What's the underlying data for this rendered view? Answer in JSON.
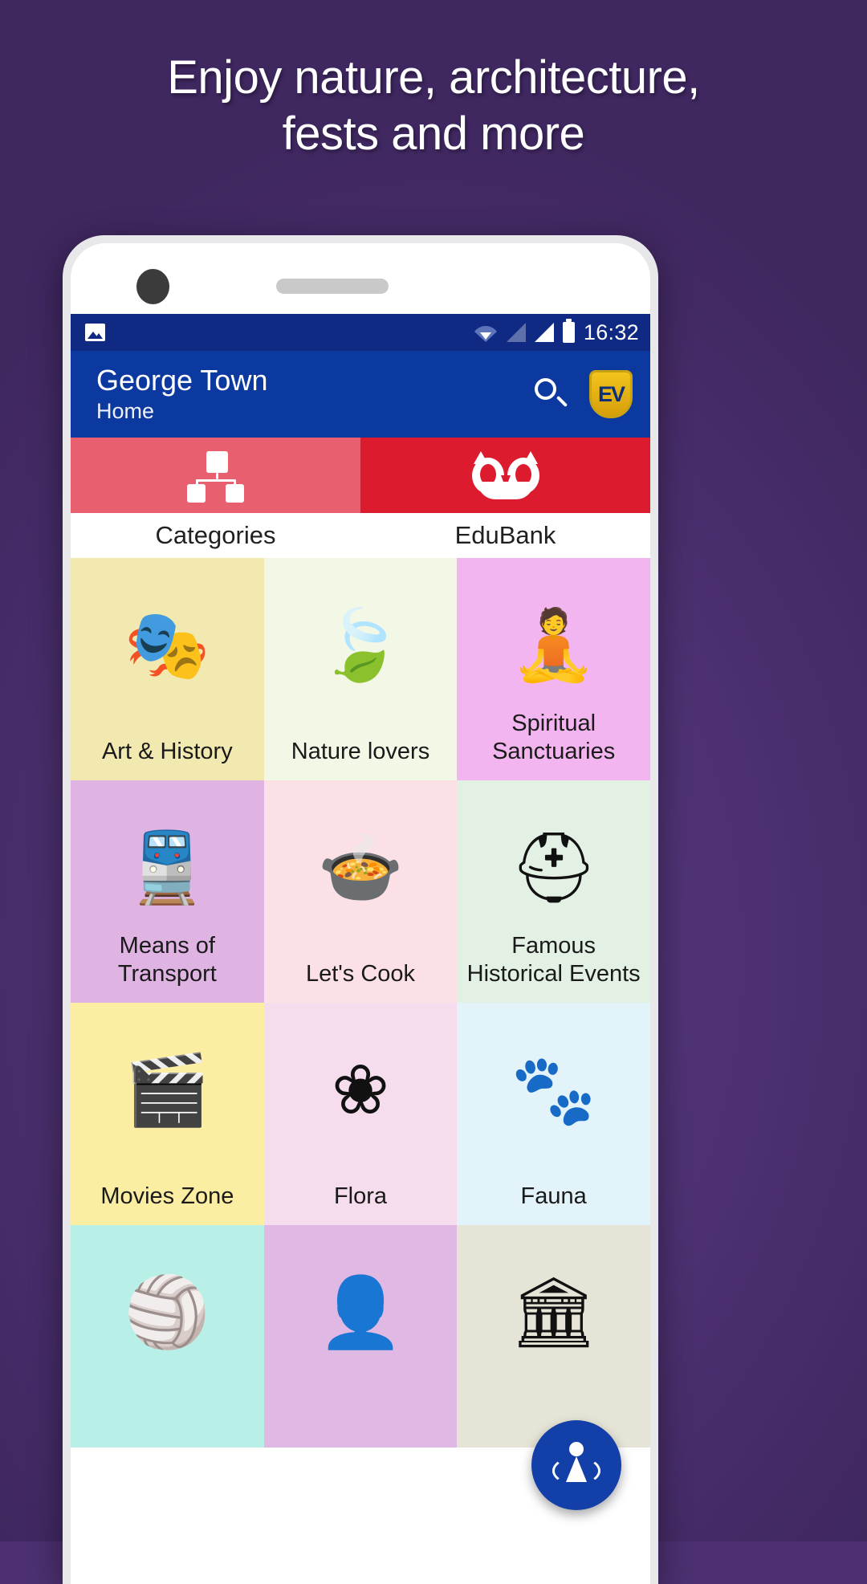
{
  "promo": {
    "headline_line1": "Enjoy nature, architecture,",
    "headline_line2": "fests and more",
    "background_color": "#4c3070"
  },
  "status_bar": {
    "photo_icon": "photo-icon",
    "wifi_icon": "wifi-icon",
    "signal_icon_1": "signal-empty-icon",
    "signal_icon_2": "signal-full-icon",
    "battery_icon": "battery-icon",
    "time": "16:32",
    "background_color": "#102a83"
  },
  "app_bar": {
    "title": "George Town",
    "subtitle": "Home",
    "search_icon": "search-icon",
    "brand_badge_text": "EV",
    "background_color": "#0b39a0"
  },
  "tabs": [
    {
      "label": "Categories",
      "icon": "sitemap-icon",
      "color": "#e86070",
      "selected": true
    },
    {
      "label": "EduBank",
      "icon": "owl-icon",
      "color": "#dd1b2e",
      "selected": false
    }
  ],
  "categories": [
    {
      "label": "Art & History",
      "icon": "theater-masks-icon",
      "glyph": "🎭",
      "color": "#f2e9b0"
    },
    {
      "label": "Nature lovers",
      "icon": "leaf-icon",
      "glyph": "🍃",
      "color": "#f3f8e6"
    },
    {
      "label": "Spiritual Sanctuaries",
      "icon": "buddha-icon",
      "glyph": "🧘",
      "color": "#f3b5f0"
    },
    {
      "label": "Means of Transport",
      "icon": "train-icon",
      "glyph": "🚆",
      "color": "#dfb4e3"
    },
    {
      "label": "Let's Cook",
      "icon": "food-cloche-icon",
      "glyph": "🍲",
      "color": "#fbe1e6"
    },
    {
      "label": "Famous Historical Events",
      "icon": "helmet-icon",
      "glyph": "⛑",
      "color": "#e3f0e4"
    },
    {
      "label": "Movies Zone",
      "icon": "clapperboard-icon",
      "glyph": "🎬",
      "color": "#fbeda2"
    },
    {
      "label": "Flora",
      "icon": "flower-icon",
      "glyph": "❀",
      "color": "#f5ddee"
    },
    {
      "label": "Fauna",
      "icon": "paw-icon",
      "glyph": "🐾",
      "color": "#e2f4fa"
    },
    {
      "label": "",
      "icon": "ball-icon",
      "glyph": "🏐",
      "color": "#b8f0e8"
    },
    {
      "label": "",
      "icon": "person-icon",
      "glyph": "👤",
      "color": "#dfb8e3"
    },
    {
      "label": "",
      "icon": "building-icon",
      "glyph": "🏛",
      "color": "#e6e4d6"
    }
  ],
  "fab": {
    "icon": "person-pin-icon",
    "color": "#1340a8"
  }
}
